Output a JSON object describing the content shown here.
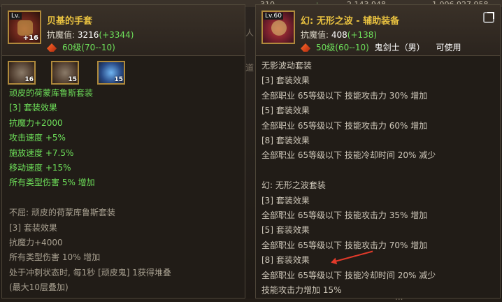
{
  "background": {
    "stats": [
      "310",
      "2,143,948",
      "1,006,927,958"
    ],
    "texts": [
      "人",
      "道",
      "..."
    ]
  },
  "left_item": {
    "level_badge": "Lv.",
    "enhance": "+16",
    "name": "贝基的手套",
    "stat_label": "抗魔值:",
    "stat_value": "3216",
    "stat_bonus": "(+3344)",
    "level_range": "60级(70--10)",
    "set_icons": [
      {
        "name": "gauntlet-icon",
        "count": "16"
      },
      {
        "name": "bracer-icon",
        "count": "15"
      },
      {
        "name": "orb-icon",
        "count": "15"
      }
    ],
    "lines": [
      {
        "text": "顽皮的荷蒙库鲁斯套装",
        "cls": "g"
      },
      {
        "text": "[3] 套装效果",
        "cls": "g"
      },
      {
        "text": "抗魔力+2000",
        "cls": "g"
      },
      {
        "text": "攻击速度 +5%",
        "cls": "g"
      },
      {
        "text": "施放速度 +7.5%",
        "cls": "g"
      },
      {
        "text": "移动速度 +15%",
        "cls": "g"
      },
      {
        "text": "所有类型伤害 5% 增加",
        "cls": "g"
      },
      {
        "text": "",
        "cls": "w"
      },
      {
        "text": "不屈: 顽皮的荷蒙库鲁斯套装",
        "cls": "gray"
      },
      {
        "text": "[3] 套装效果",
        "cls": "gray"
      },
      {
        "text": "抗魔力+4000",
        "cls": "gray"
      },
      {
        "text": "所有类型伤害 10% 增加",
        "cls": "gray"
      },
      {
        "text": "处于冲刺状态时, 每1秒 [顽皮鬼] 1获得堆叠",
        "cls": "gray"
      },
      {
        "text": "(最大10层叠加)",
        "cls": "gray"
      }
    ]
  },
  "right_item": {
    "level_badge": "Lv.60",
    "name": "幻: 无形之波 - 辅助装备",
    "stat_label": "抗魔值:",
    "stat_value": "408",
    "stat_bonus": "(+138)",
    "level_range": "50级(60--10)",
    "class_name": "鬼剑士（男）",
    "usable": "可使用",
    "lines": [
      {
        "text": "无影波动套装",
        "cls": "w"
      },
      {
        "text": "[3] 套装效果",
        "cls": "w"
      },
      {
        "text": "全部职业 65等级以下 技能攻击力 30% 增加",
        "cls": "w"
      },
      {
        "text": "[5] 套装效果",
        "cls": "w"
      },
      {
        "text": "全部职业 65等级以下 技能攻击力 60% 增加",
        "cls": "w"
      },
      {
        "text": "[8] 套装效果",
        "cls": "w"
      },
      {
        "text": "全部职业 65等级以下 技能冷却时间 20% 减少",
        "cls": "w"
      },
      {
        "text": "",
        "cls": "w"
      },
      {
        "text": "幻: 无形之波套装",
        "cls": "w"
      },
      {
        "text": "[3] 套装效果",
        "cls": "w"
      },
      {
        "text": "全部职业 65等级以下 技能攻击力 35% 增加",
        "cls": "w"
      },
      {
        "text": "[5] 套装效果",
        "cls": "w"
      },
      {
        "text": "全部职业 65等级以下 技能攻击力 70% 增加",
        "cls": "w"
      },
      {
        "text": "[8] 套装效果",
        "cls": "w"
      },
      {
        "text": "全部职业 65等级以下 技能冷却时间 20% 减少",
        "cls": "w"
      },
      {
        "text": "技能攻击力增加 15%",
        "cls": "w"
      }
    ]
  }
}
